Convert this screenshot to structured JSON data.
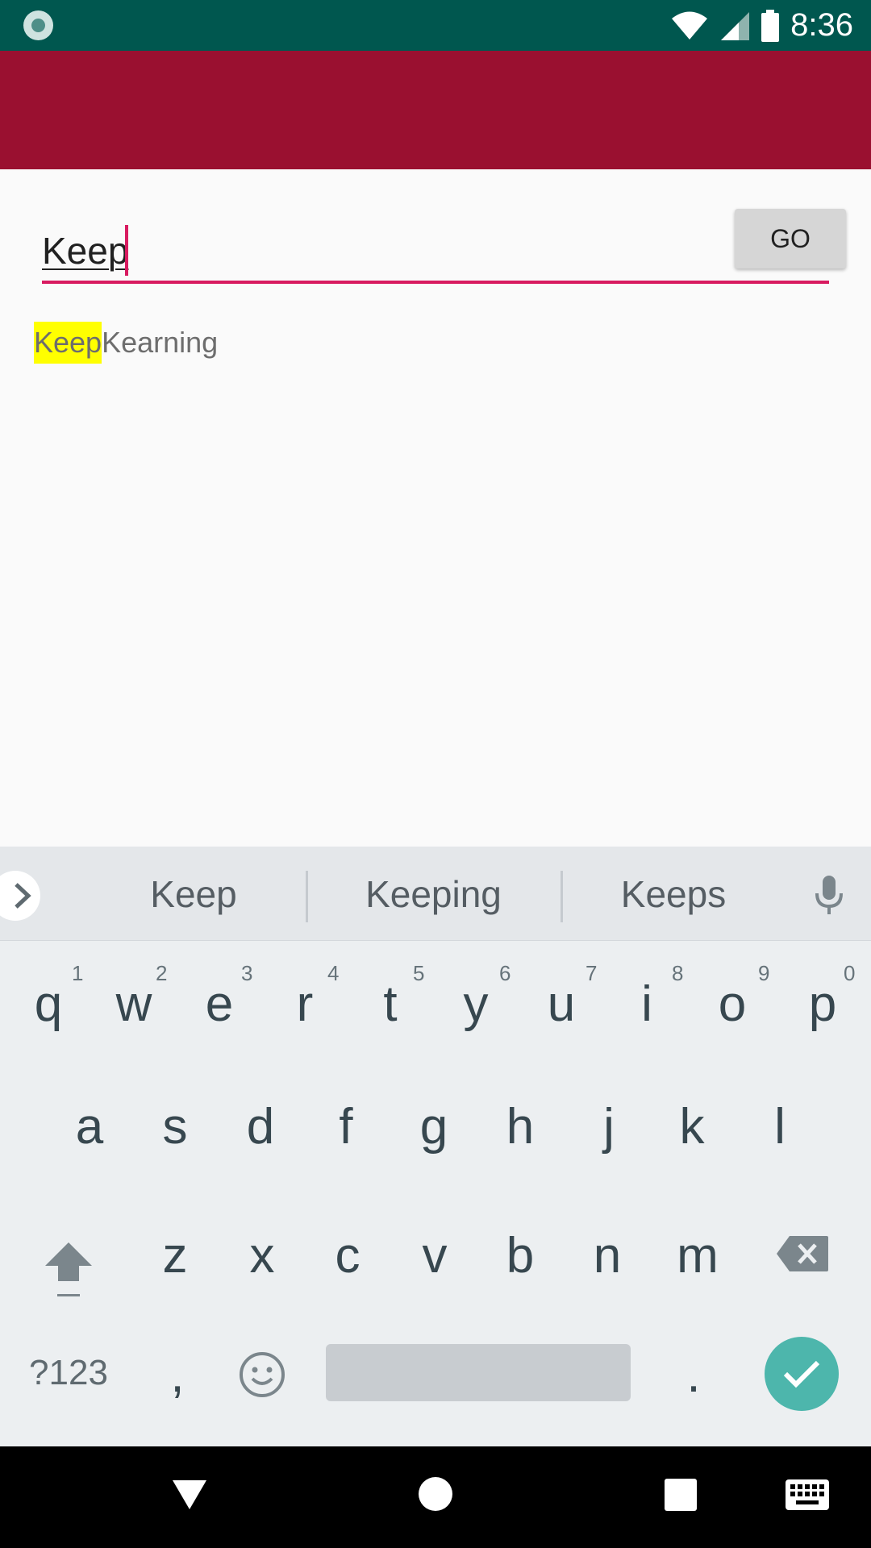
{
  "status_bar": {
    "time": "8:36"
  },
  "search": {
    "value": "Keep",
    "go_label": "GO"
  },
  "result": {
    "highlighted": "Keep",
    "rest": " Kearning",
    "highlight_color": "#ffff00"
  },
  "keyboard": {
    "suggestions": [
      "Keep",
      "Keeping",
      "Keeps"
    ],
    "row1": [
      "q",
      "w",
      "e",
      "r",
      "t",
      "y",
      "u",
      "i",
      "o",
      "p"
    ],
    "row1_hints": [
      "1",
      "2",
      "3",
      "4",
      "5",
      "6",
      "7",
      "8",
      "9",
      "0"
    ],
    "row2": [
      "a",
      "s",
      "d",
      "f",
      "g",
      "h",
      "j",
      "k",
      "l"
    ],
    "row3": [
      "z",
      "x",
      "c",
      "v",
      "b",
      "n",
      "m"
    ],
    "symbols_label": "?123",
    "comma": ",",
    "period": "."
  },
  "colors": {
    "status_bar": "#00574f",
    "app_bar": "#9a1030",
    "accent": "#d81b60",
    "enter_key": "#4db6ac"
  }
}
